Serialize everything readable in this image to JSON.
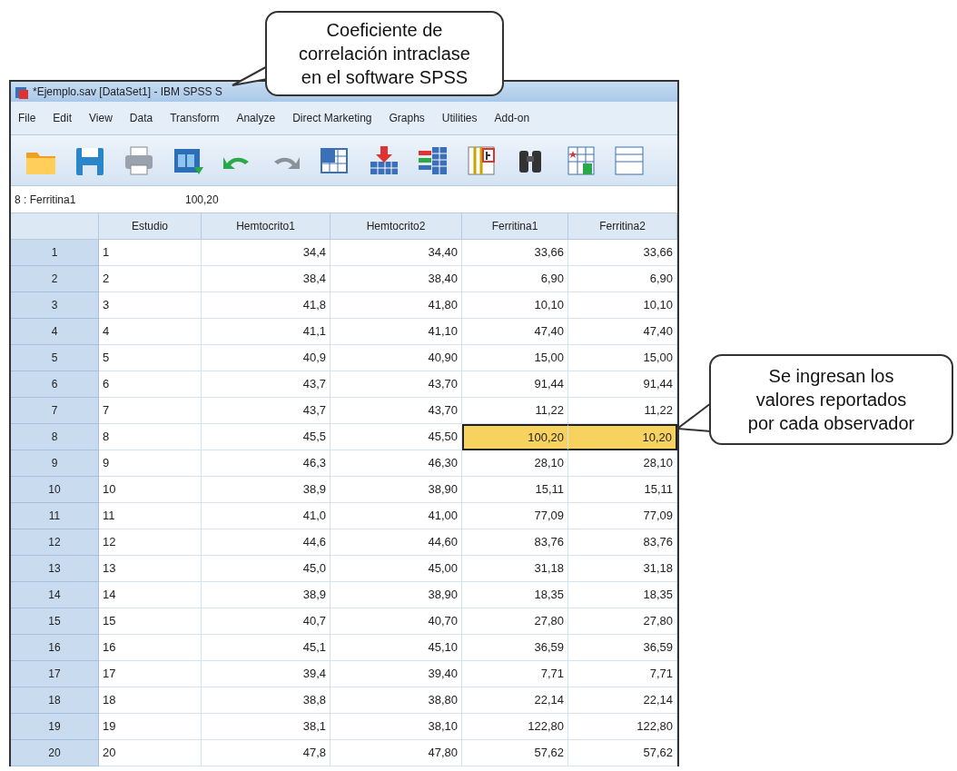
{
  "callouts": [
    {
      "kind": "top",
      "text": "Coeficiente de correlación intraclase en el software SPSS"
    },
    {
      "kind": "right",
      "text": "Se ingresan los valores reportados por cada observador"
    }
  ],
  "window": {
    "title": "*Ejemplo.sav [DataSet1] - IBM SPSS S"
  },
  "menu": [
    "File",
    "Edit",
    "View",
    "Data",
    "Transform",
    "Analyze",
    "Direct Marketing",
    "Graphs",
    "Utilities",
    "Add-on"
  ],
  "toolbar": [
    {
      "kind": "folder"
    },
    {
      "kind": "save"
    },
    {
      "kind": "printer"
    },
    {
      "kind": "dialog"
    },
    {
      "kind": "undo"
    },
    {
      "kind": "redo"
    },
    {
      "kind": "goto"
    },
    {
      "kind": "insert"
    },
    {
      "kind": "variables"
    },
    {
      "kind": "stats"
    },
    {
      "kind": "find"
    },
    {
      "kind": "star"
    },
    {
      "kind": "cut"
    }
  ],
  "cell_editor": {
    "cell": "8 : Ferritina1",
    "value": "100,20"
  },
  "columns": [
    {
      "label": "Estudio",
      "kind": "string"
    },
    {
      "label": "Hemtocrito1",
      "kind": "numeric"
    },
    {
      "label": "Hemtocrito2",
      "kind": "numeric"
    },
    {
      "label": "Ferritina1",
      "kind": "numeric"
    },
    {
      "label": "Ferritina2",
      "kind": "numeric"
    }
  ],
  "rows": [
    {
      "number": "1",
      "cells": [
        {
          "text": "1",
          "highlighted": false
        },
        {
          "text": "34,4",
          "highlighted": false
        },
        {
          "text": "34,40",
          "highlighted": false
        },
        {
          "text": "33,66",
          "highlighted": false
        },
        {
          "text": "33,66",
          "highlighted": false
        }
      ]
    },
    {
      "number": "2",
      "cells": [
        {
          "text": "2",
          "highlighted": false
        },
        {
          "text": "38,4",
          "highlighted": false
        },
        {
          "text": "38,40",
          "highlighted": false
        },
        {
          "text": "6,90",
          "highlighted": false
        },
        {
          "text": "6,90",
          "highlighted": false
        }
      ]
    },
    {
      "number": "3",
      "cells": [
        {
          "text": "3",
          "highlighted": false
        },
        {
          "text": "41,8",
          "highlighted": false
        },
        {
          "text": "41,80",
          "highlighted": false
        },
        {
          "text": "10,10",
          "highlighted": false
        },
        {
          "text": "10,10",
          "highlighted": false
        }
      ]
    },
    {
      "number": "4",
      "cells": [
        {
          "text": "4",
          "highlighted": false
        },
        {
          "text": "41,1",
          "highlighted": false
        },
        {
          "text": "41,10",
          "highlighted": false
        },
        {
          "text": "47,40",
          "highlighted": false
        },
        {
          "text": "47,40",
          "highlighted": false
        }
      ]
    },
    {
      "number": "5",
      "cells": [
        {
          "text": "5",
          "highlighted": false
        },
        {
          "text": "40,9",
          "highlighted": false
        },
        {
          "text": "40,90",
          "highlighted": false
        },
        {
          "text": "15,00",
          "highlighted": false
        },
        {
          "text": "15,00",
          "highlighted": false
        }
      ]
    },
    {
      "number": "6",
      "cells": [
        {
          "text": "6",
          "highlighted": false
        },
        {
          "text": "43,7",
          "highlighted": false
        },
        {
          "text": "43,70",
          "highlighted": false
        },
        {
          "text": "91,44",
          "highlighted": false
        },
        {
          "text": "91,44",
          "highlighted": false
        }
      ]
    },
    {
      "number": "7",
      "cells": [
        {
          "text": "7",
          "highlighted": false
        },
        {
          "text": "43,7",
          "highlighted": false
        },
        {
          "text": "43,70",
          "highlighted": false
        },
        {
          "text": "11,22",
          "highlighted": false
        },
        {
          "text": "11,22",
          "highlighted": false
        }
      ]
    },
    {
      "number": "8",
      "cells": [
        {
          "text": "8",
          "highlighted": false
        },
        {
          "text": "45,5",
          "highlighted": false
        },
        {
          "text": "45,50",
          "highlighted": false
        },
        {
          "text": "100,20",
          "highlighted": true
        },
        {
          "text": "10,20",
          "highlighted": true
        }
      ]
    },
    {
      "number": "9",
      "cells": [
        {
          "text": "9",
          "highlighted": false
        },
        {
          "text": "46,3",
          "highlighted": false
        },
        {
          "text": "46,30",
          "highlighted": false
        },
        {
          "text": "28,10",
          "highlighted": false
        },
        {
          "text": "28,10",
          "highlighted": false
        }
      ]
    },
    {
      "number": "10",
      "cells": [
        {
          "text": "10",
          "highlighted": false
        },
        {
          "text": "38,9",
          "highlighted": false
        },
        {
          "text": "38,90",
          "highlighted": false
        },
        {
          "text": "15,11",
          "highlighted": false
        },
        {
          "text": "15,11",
          "highlighted": false
        }
      ]
    },
    {
      "number": "11",
      "cells": [
        {
          "text": "11",
          "highlighted": false
        },
        {
          "text": "41,0",
          "highlighted": false
        },
        {
          "text": "41,00",
          "highlighted": false
        },
        {
          "text": "77,09",
          "highlighted": false
        },
        {
          "text": "77,09",
          "highlighted": false
        }
      ]
    },
    {
      "number": "12",
      "cells": [
        {
          "text": "12",
          "highlighted": false
        },
        {
          "text": "44,6",
          "highlighted": false
        },
        {
          "text": "44,60",
          "highlighted": false
        },
        {
          "text": "83,76",
          "highlighted": false
        },
        {
          "text": "83,76",
          "highlighted": false
        }
      ]
    },
    {
      "number": "13",
      "cells": [
        {
          "text": "13",
          "highlighted": false
        },
        {
          "text": "45,0",
          "highlighted": false
        },
        {
          "text": "45,00",
          "highlighted": false
        },
        {
          "text": "31,18",
          "highlighted": false
        },
        {
          "text": "31,18",
          "highlighted": false
        }
      ]
    },
    {
      "number": "14",
      "cells": [
        {
          "text": "14",
          "highlighted": false
        },
        {
          "text": "38,9",
          "highlighted": false
        },
        {
          "text": "38,90",
          "highlighted": false
        },
        {
          "text": "18,35",
          "highlighted": false
        },
        {
          "text": "18,35",
          "highlighted": false
        }
      ]
    },
    {
      "number": "15",
      "cells": [
        {
          "text": "15",
          "highlighted": false
        },
        {
          "text": "40,7",
          "highlighted": false
        },
        {
          "text": "40,70",
          "highlighted": false
        },
        {
          "text": "27,80",
          "highlighted": false
        },
        {
          "text": "27,80",
          "highlighted": false
        }
      ]
    },
    {
      "number": "16",
      "cells": [
        {
          "text": "16",
          "highlighted": false
        },
        {
          "text": "45,1",
          "highlighted": false
        },
        {
          "text": "45,10",
          "highlighted": false
        },
        {
          "text": "36,59",
          "highlighted": false
        },
        {
          "text": "36,59",
          "highlighted": false
        }
      ]
    },
    {
      "number": "17",
      "cells": [
        {
          "text": "17",
          "highlighted": false
        },
        {
          "text": "39,4",
          "highlighted": false
        },
        {
          "text": "39,40",
          "highlighted": false
        },
        {
          "text": "7,71",
          "highlighted": false
        },
        {
          "text": "7,71",
          "highlighted": false
        }
      ]
    },
    {
      "number": "18",
      "cells": [
        {
          "text": "18",
          "highlighted": false
        },
        {
          "text": "38,8",
          "highlighted": false
        },
        {
          "text": "38,80",
          "highlighted": false
        },
        {
          "text": "22,14",
          "highlighted": false
        },
        {
          "text": "22,14",
          "highlighted": false
        }
      ]
    },
    {
      "number": "19",
      "cells": [
        {
          "text": "19",
          "highlighted": false
        },
        {
          "text": "38,1",
          "highlighted": false
        },
        {
          "text": "38,10",
          "highlighted": false
        },
        {
          "text": "122,80",
          "highlighted": false
        },
        {
          "text": "122,80",
          "highlighted": false
        }
      ]
    },
    {
      "number": "20",
      "cells": [
        {
          "text": "20",
          "highlighted": false
        },
        {
          "text": "47,8",
          "highlighted": false
        },
        {
          "text": "47,80",
          "highlighted": false
        },
        {
          "text": "57,62",
          "highlighted": false
        },
        {
          "text": "57,62",
          "highlighted": false
        }
      ]
    }
  ]
}
